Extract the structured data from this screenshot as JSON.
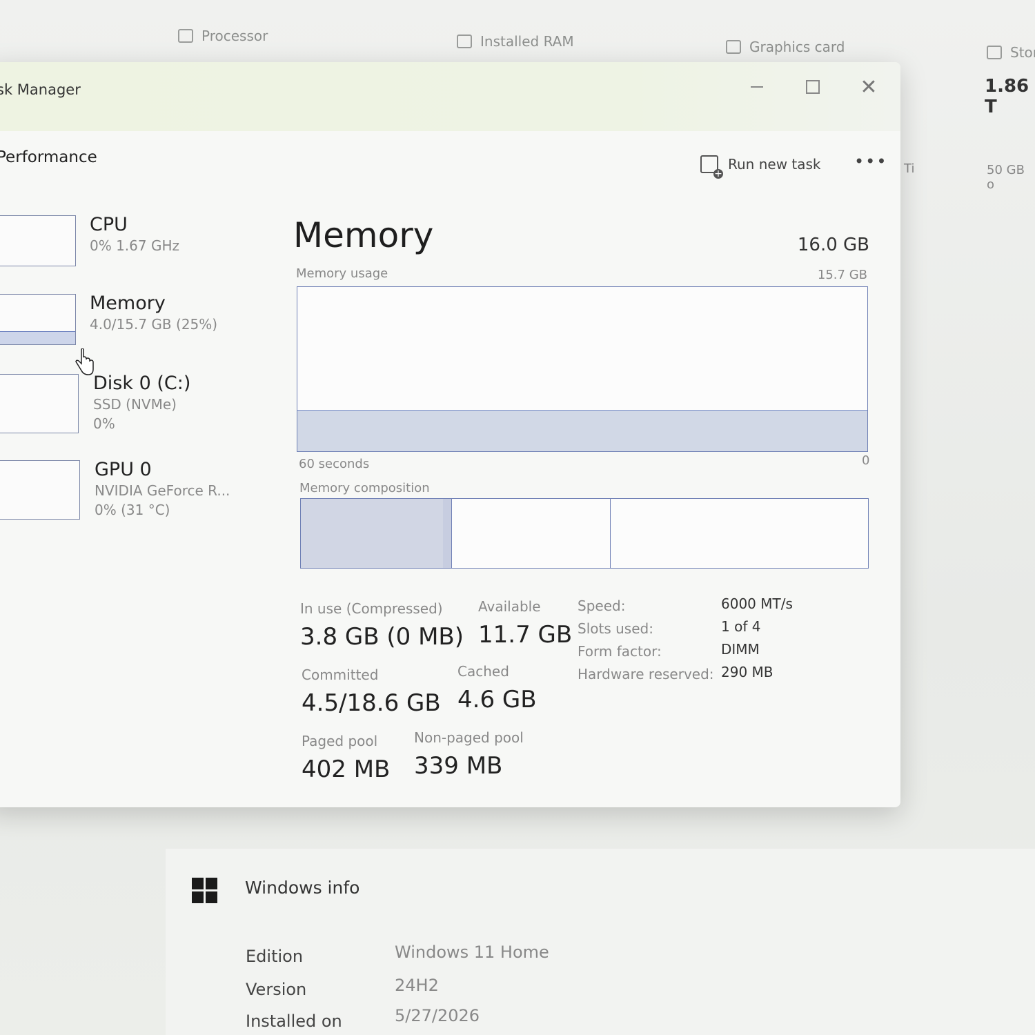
{
  "background": {
    "specs": [
      {
        "label": "Processor"
      },
      {
        "label": "Installed RAM"
      },
      {
        "label": "Graphics card"
      },
      {
        "label": "Stor"
      }
    ],
    "right_value": "1.86 T",
    "right_sub": "50 GB o",
    "right_ti": "Ti",
    "windows_info": {
      "title": "Windows info",
      "rows": [
        {
          "label": "Edition",
          "value": "Windows 11 Home"
        },
        {
          "label": "Version",
          "value": "24H2"
        },
        {
          "label": "Installed on",
          "value": "5/27/2026"
        }
      ]
    }
  },
  "task_manager": {
    "title": "sk Manager",
    "page_title": "Performance",
    "toolbar": {
      "run_new_task": "Run new task",
      "more": "•••"
    },
    "resources": [
      {
        "name": "CPU",
        "sub1": "0%  1.67 GHz",
        "sub2": ""
      },
      {
        "name": "Memory",
        "sub1": "4.0/15.7 GB (25%)",
        "sub2": ""
      },
      {
        "name": "Disk 0 (C:)",
        "sub1": "SSD (NVMe)",
        "sub2": "0%"
      },
      {
        "name": "GPU 0",
        "sub1": "NVIDIA GeForce R...",
        "sub2": "0%  (31 °C)"
      }
    ],
    "memory": {
      "heading": "Memory",
      "total": "16.0 GB",
      "usage_label": "Memory usage",
      "usage_max": "15.7 GB",
      "usage_level": 0.25,
      "axis_left": "60 seconds",
      "axis_right": "0",
      "composition_label": "Memory composition",
      "composition": {
        "in_use_fraction": 0.25,
        "modified_fraction": 0.015,
        "standby_fraction": 0.28
      },
      "stats": {
        "in_use_label": "In use (Compressed)",
        "in_use_value": "3.8 GB (0 MB)",
        "available_label": "Available",
        "available_value": "11.7 GB",
        "committed_label": "Committed",
        "committed_value": "4.5/18.6 GB",
        "cached_label": "Cached",
        "cached_value": "4.6 GB",
        "paged_label": "Paged pool",
        "paged_value": "402 MB",
        "nonpaged_label": "Non-paged pool",
        "nonpaged_value": "339 MB"
      },
      "specs": [
        {
          "label": "Speed:",
          "value": "6000 MT/s"
        },
        {
          "label": "Slots used:",
          "value": "1 of 4"
        },
        {
          "label": "Form factor:",
          "value": "DIMM"
        },
        {
          "label": "Hardware reserved:",
          "value": "290 MB"
        }
      ]
    }
  }
}
